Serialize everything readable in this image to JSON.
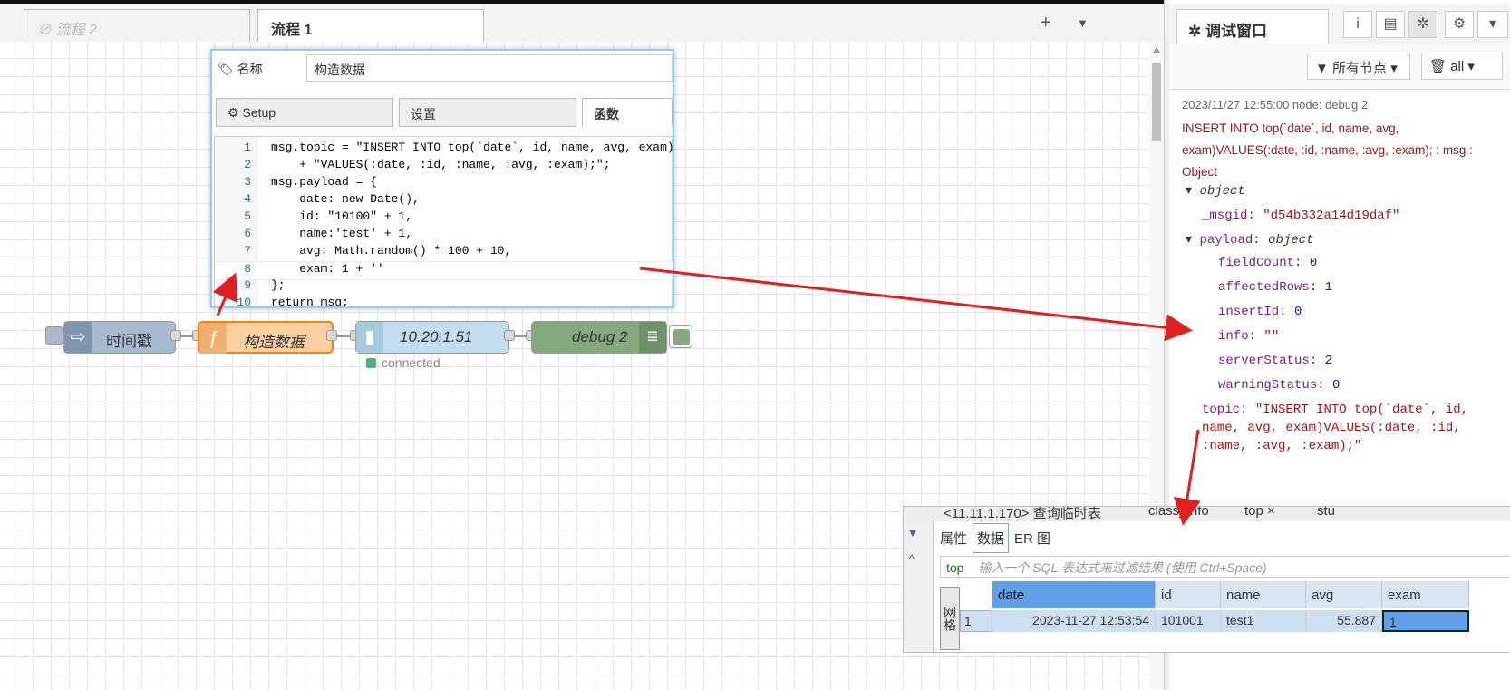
{
  "workspace": {
    "tab_inactive_label": "流程 2",
    "tab_active_label": "流程 1",
    "add_icon": "plus-icon",
    "menu_icon": "chevron-down-icon"
  },
  "editor": {
    "name_label": "名称",
    "name_value": "构造数据",
    "tabs": [
      "Setup",
      "设置",
      "函数"
    ],
    "code_lines": [
      {
        "n": "1",
        "text": "msg.topic = \"INSERT INTO top(`date`, id, name, avg, exam)\""
      },
      {
        "n": "2",
        "text": "    + \"VALUES(:date, :id, :name, :avg, :exam);\";"
      },
      {
        "n": "3",
        "text": "msg.payload = {"
      },
      {
        "n": "4",
        "text": "    date: new Date(),"
      },
      {
        "n": "5",
        "text": "    id: \"10100\" + 1,"
      },
      {
        "n": "6",
        "text": "    name:'test' + 1,"
      },
      {
        "n": "7",
        "text": "    avg: Math.random() * 100 + 10,"
      },
      {
        "n": "8",
        "text": "    exam: 1 + ''"
      },
      {
        "n": "9",
        "text": "};"
      },
      {
        "n": "10",
        "text": "return msg;"
      }
    ]
  },
  "flow": {
    "nodes": [
      "时间戳",
      "构造数据",
      "10.20.1.51",
      "debug 2"
    ],
    "db_status": "connected"
  },
  "sidebar": {
    "title": "调试窗口",
    "filter_label": "所有节点",
    "clear_label": "all",
    "msg_meta": "2023/11/27 12:55:00   node: debug 2",
    "msg_topic": "INSERT INTO top(`date`, id, name, avg, exam)VALUES(:date, :id, :name, :avg, :exam); : msg : Object",
    "tree": {
      "root": "object",
      "msgid_key": "_msgid",
      "msgid_val": "\"d54b332a14d19daf\"",
      "payload_key": "payload",
      "payload_type": "object",
      "fields": [
        {
          "k": "fieldCount",
          "v": "0"
        },
        {
          "k": "affectedRows",
          "v": "1"
        },
        {
          "k": "insertId",
          "v": "0"
        },
        {
          "k": "info",
          "v": "\"\""
        },
        {
          "k": "serverStatus",
          "v": "2"
        },
        {
          "k": "warningStatus",
          "v": "0"
        }
      ],
      "topic_key": "topic",
      "topic_lines": [
        "\"INSERT INTO top(`date`, id,",
        "name, avg, exam)VALUES(:date, :id,",
        ":name, :avg, :exam);\""
      ]
    }
  },
  "db": {
    "tabs": [
      "<11.11.1.170> 查询临时表",
      "class_info",
      "top ×",
      "stu"
    ],
    "subtabs": [
      "属性",
      "数据",
      "ER 图"
    ],
    "table_name": "top",
    "filter_placeholder": "输入一个 SQL 表达式来过滤结果 (使用 Ctrl+Space)",
    "grid_label": "网格",
    "columns": [
      "date",
      "id",
      "name",
      "avg",
      "exam"
    ],
    "row": {
      "num": "1",
      "date": "2023-11-27 12:53:54",
      "id": "101001",
      "name": "test1",
      "avg": "55.887",
      "exam": "1"
    }
  }
}
